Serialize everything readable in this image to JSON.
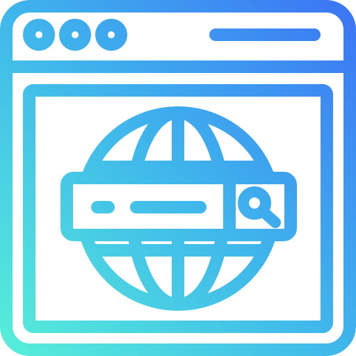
{
  "icon": {
    "name": "browser-web-search-icon",
    "parts": [
      "browser-window-icon",
      "window-dot-icon",
      "address-bar-icon",
      "globe-icon",
      "search-bar-icon",
      "magnifier-icon"
    ]
  },
  "colors": {
    "gradient_start": "#56F0D8",
    "gradient_mid": "#3FB6EC",
    "gradient_end": "#3C73F5",
    "background": "#FFFFFF"
  }
}
